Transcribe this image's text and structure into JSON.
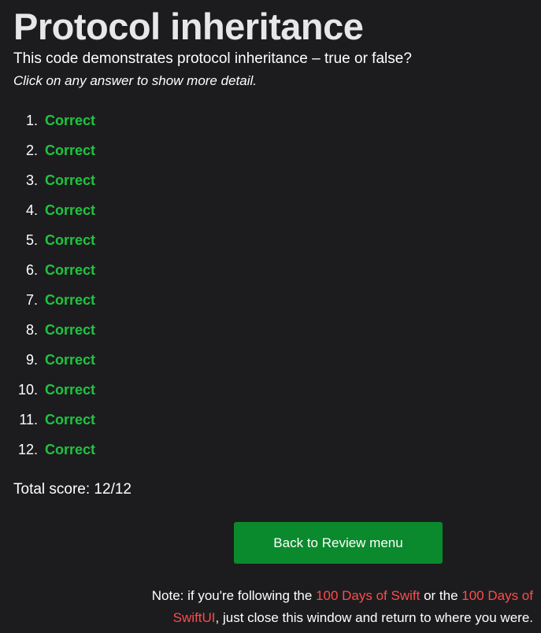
{
  "header": {
    "title": "Protocol inheritance",
    "question": "This code demonstrates protocol inheritance – true or false?",
    "instruction": "Click on any answer to show more detail."
  },
  "answers": [
    {
      "number": "1.",
      "label": "Correct"
    },
    {
      "number": "2.",
      "label": "Correct"
    },
    {
      "number": "3.",
      "label": "Correct"
    },
    {
      "number": "4.",
      "label": "Correct"
    },
    {
      "number": "5.",
      "label": "Correct"
    },
    {
      "number": "6.",
      "label": "Correct"
    },
    {
      "number": "7.",
      "label": "Correct"
    },
    {
      "number": "8.",
      "label": "Correct"
    },
    {
      "number": "9.",
      "label": "Correct"
    },
    {
      "number": "10.",
      "label": "Correct"
    },
    {
      "number": "11.",
      "label": "Correct"
    },
    {
      "number": "12.",
      "label": "Correct"
    }
  ],
  "score": {
    "text": "Total score: 12/12"
  },
  "back_button": {
    "label": "Back to Review menu"
  },
  "note": {
    "prefix": "Note: if you're following the ",
    "link1": "100 Days of Swift",
    "middle": " or the ",
    "link2": "100 Days of SwiftUI",
    "suffix": ", just close this window and return to where you were."
  },
  "colors": {
    "background": "#1c1c1e",
    "correct": "#1fc43f",
    "button": "#0a8a2c",
    "link": "#ff4b4b"
  }
}
